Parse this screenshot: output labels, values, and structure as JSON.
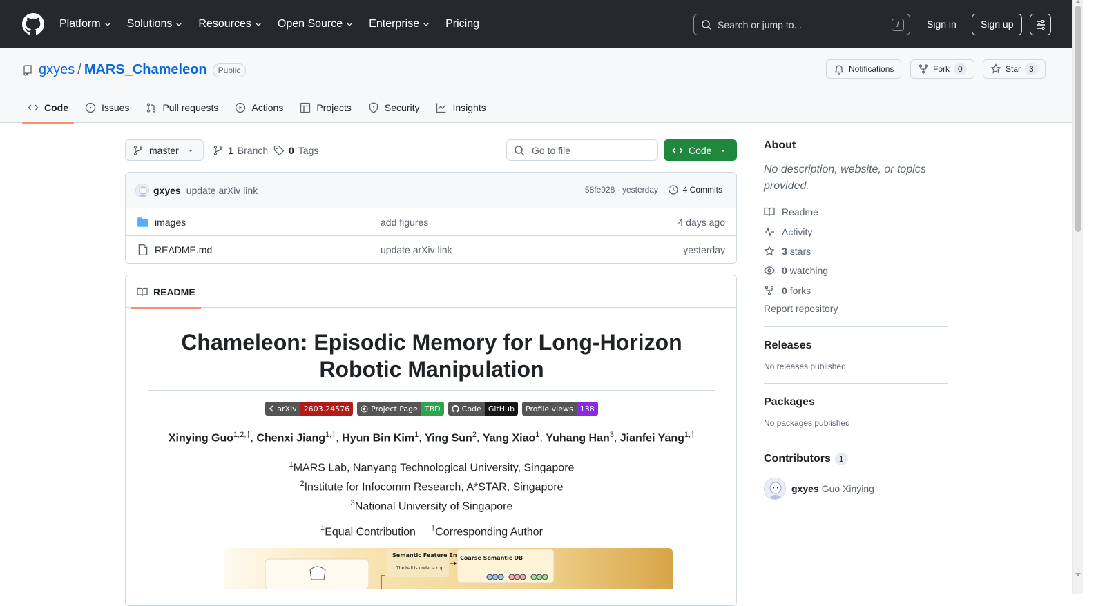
{
  "topnav": {
    "items": [
      "Platform",
      "Solutions",
      "Resources",
      "Open Source",
      "Enterprise",
      "Pricing"
    ],
    "search_placeholder": "Search or jump to...",
    "search_shortcut": "/",
    "signin": "Sign in",
    "signup": "Sign up"
  },
  "repo": {
    "owner": "gxyes",
    "separator": "/",
    "name": "MARS_Chameleon",
    "visibility": "Public",
    "notifications_label": "Notifications",
    "fork_label": "Fork",
    "fork_count": "0",
    "star_label": "Star",
    "star_count": "3"
  },
  "tabs": [
    "Code",
    "Issues",
    "Pull requests",
    "Actions",
    "Projects",
    "Security",
    "Insights"
  ],
  "filebar": {
    "branch": "master",
    "branch_count": "1",
    "branch_label": "Branch",
    "tag_count": "0",
    "tag_label": "Tags",
    "gofile_placeholder": "Go to file",
    "code_button": "Code"
  },
  "latest_commit": {
    "author": "gxyes",
    "message": "update arXiv link",
    "meta": "58fe928 · yesterday",
    "commits_label": "4 Commits"
  },
  "files": [
    {
      "name": "images",
      "type": "folder",
      "message": "add figures",
      "date": "4 days ago"
    },
    {
      "name": "README.md",
      "type": "file",
      "message": "update arXiv link",
      "date": "yesterday"
    }
  ],
  "readme": {
    "tab_label": "README",
    "title": "Chameleon: Episodic Memory for Long-Horizon Robotic Manipulation",
    "badges": [
      {
        "left": "arXiv",
        "right": "2603.24576",
        "color": "#b31b1b"
      },
      {
        "left": "Project Page",
        "right": "TBD",
        "color": "#2ea44f"
      },
      {
        "left": "Code",
        "right": "GitHub",
        "color": "#181717"
      },
      {
        "left": "Profile views",
        "right": "138",
        "color": "#8a2be2"
      }
    ],
    "authors": [
      {
        "name": "Xinying Guo",
        "sup": "1,2,‡"
      },
      {
        "name": "Chenxi Jiang",
        "sup": "1,‡"
      },
      {
        "name": "Hyun Bin Kim",
        "sup": "1"
      },
      {
        "name": "Ying Sun",
        "sup": "2"
      },
      {
        "name": "Yang Xiao",
        "sup": "1"
      },
      {
        "name": "Yuhang Han",
        "sup": "3"
      },
      {
        "name": "Jianfei Yang",
        "sup": "1,†"
      }
    ],
    "affiliations": [
      {
        "sup": "1",
        "text": "MARS Lab, Nanyang Technological University, Singapore"
      },
      {
        "sup": "2",
        "text": "Institute for Infocomm Research, A*STAR, Singapore"
      },
      {
        "sup": "3",
        "text": "National University of Singapore"
      }
    ],
    "notes": [
      {
        "sup": "‡",
        "text": "Equal Contribution"
      },
      {
        "sup": "†",
        "text": "Corresponding Author"
      }
    ],
    "figure_text": {
      "encoder": "Semantic Feature Encoder",
      "caption": "The ball is under a cup.",
      "db": "Coarse Semantic DB"
    }
  },
  "sidebar": {
    "about_title": "About",
    "about_desc": "No description, website, or topics provided.",
    "readme": "Readme",
    "activity": "Activity",
    "stars_count": "3",
    "stars_label": "stars",
    "watching_count": "0",
    "watching_label": "watching",
    "forks_count": "0",
    "forks_label": "forks",
    "report": "Report repository",
    "releases_title": "Releases",
    "releases_empty": "No releases published",
    "packages_title": "Packages",
    "packages_empty": "No packages published",
    "contributors_title": "Contributors",
    "contributors_count": "1",
    "contributor_login": "gxyes",
    "contributor_name": "Guo Xinying"
  }
}
